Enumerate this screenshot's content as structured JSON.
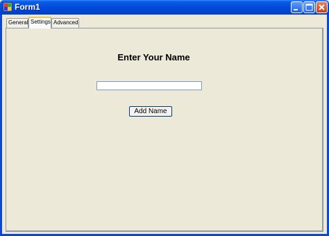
{
  "window": {
    "title": "Form1",
    "icons": {
      "app": "app-icon",
      "minimize": "minimize-icon",
      "maximize": "maximize-icon",
      "close": "close-icon"
    }
  },
  "tabs": [
    {
      "label": "General",
      "active": false
    },
    {
      "label": "Settings",
      "active": true
    },
    {
      "label": "Advanced",
      "active": false
    }
  ],
  "content": {
    "heading": "Enter Your Name",
    "name_input_value": "",
    "add_button_label": "Add Name"
  }
}
